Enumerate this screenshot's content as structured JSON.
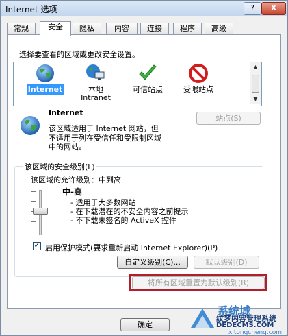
{
  "window": {
    "title": "Internet 选项",
    "help_label": "?",
    "close_label": "X"
  },
  "tabs": [
    {
      "label": "常规"
    },
    {
      "label": "安全"
    },
    {
      "label": "隐私"
    },
    {
      "label": "内容"
    },
    {
      "label": "连接"
    },
    {
      "label": "程序"
    },
    {
      "label": "高级"
    }
  ],
  "security": {
    "zone_prompt": "选择要查看的区域或更改安全设置。",
    "zones": [
      {
        "label": "Internet",
        "label2": "",
        "icon": "globe-icon"
      },
      {
        "label": "本地",
        "label2": "Intranet",
        "icon": "local-intranet-icon"
      },
      {
        "label": "可信站点",
        "label2": "",
        "icon": "checkmark-icon"
      },
      {
        "label": "受限站点",
        "label2": "",
        "icon": "no-entry-icon"
      }
    ],
    "detail": {
      "title": "Internet",
      "line1": "该区域适用于 Internet 网站，但",
      "line2": "不适用于列在受信任和受限制区域",
      "line3": "中的网站。",
      "sites_button": "站点(S)"
    },
    "level_group_label": "该区域的安全级别(L)",
    "allowed_levels": "该区域的允许级别：中到高",
    "level_name": "中-高",
    "bullets": [
      "- 适用于大多数网站",
      "- 在下载潜在的不安全内容之前提示",
      "- 不下载未签名的 ActiveX 控件"
    ],
    "protected_mode_label": "启用保护模式(要求重新启动 Internet Explorer)(P)",
    "protected_mode_checked": true,
    "custom_level_button": "自定义级别(C)...",
    "default_level_button": "默认级别(D)",
    "reset_all_button": "将所有区域重置为默认级别(R)"
  },
  "footer": {
    "ok_button": "确定"
  },
  "watermark": {
    "text1": "系统城",
    "text2": "纹梦内容管理系统",
    "text3": "DEDECMS.COM",
    "text4": "xitongcheng.com"
  },
  "colors": {
    "accent": "#3399ff",
    "highlight_box": "#b01f2a"
  }
}
